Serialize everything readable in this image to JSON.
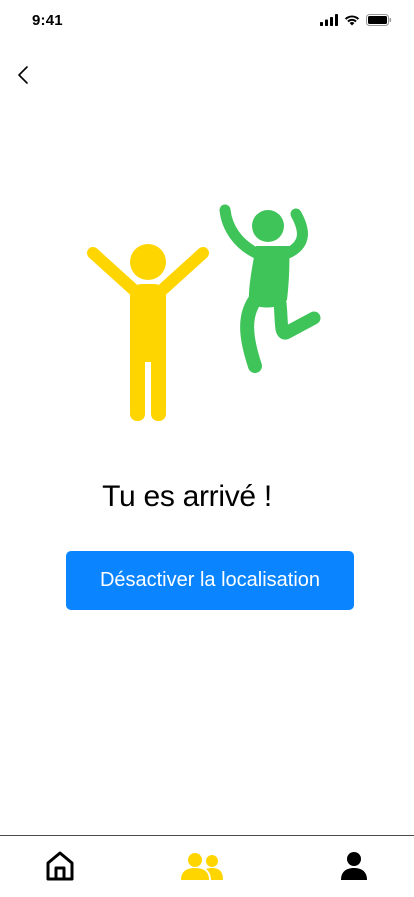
{
  "status_bar": {
    "time": "9:41",
    "icons": [
      "cellular-signal-icon",
      "wifi-icon",
      "battery-icon"
    ]
  },
  "nav": {
    "back_icon": "chevron-left-icon"
  },
  "illustration": {
    "figures": [
      {
        "name": "yellow-person",
        "color": "#FFD500"
      },
      {
        "name": "green-person-jumping",
        "color": "#3FC45A"
      }
    ]
  },
  "main": {
    "title": "Tu es arrivé !",
    "button_label": "Désactiver la localisation",
    "button_color": "#0A84FF"
  },
  "tab_bar": {
    "tabs": [
      {
        "icon": "home-icon",
        "active": false
      },
      {
        "icon": "group-icon",
        "active": true,
        "color": "#FFD500"
      },
      {
        "icon": "person-icon",
        "active": false
      }
    ]
  }
}
